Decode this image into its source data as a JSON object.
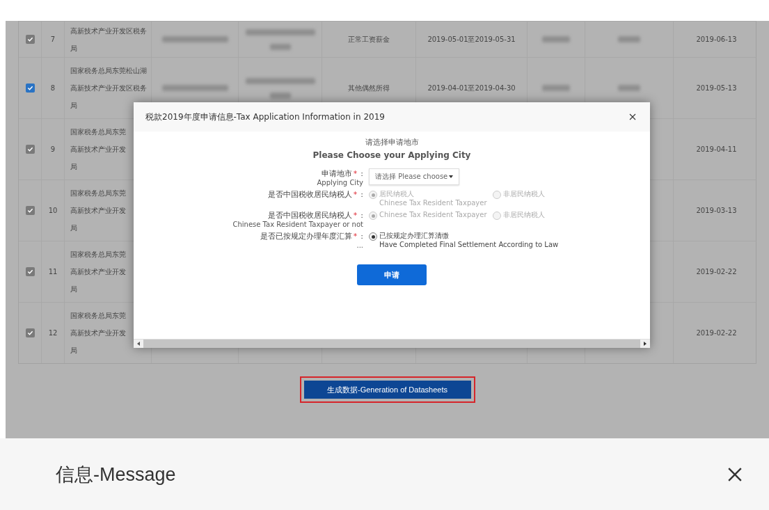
{
  "table": {
    "rows": [
      {
        "checked": true,
        "color": "#7a7a7a",
        "number": "7",
        "authority": [
          "高新技术产业开发区税务",
          "局"
        ],
        "type": "正常工资薪金",
        "period": "2019-05-01至2019-05-31",
        "date": "2019-06-13"
      },
      {
        "checked": true,
        "color": "#2a73c4",
        "number": "8",
        "authority": [
          "国家税务总局东莞松山湖",
          "高新技术产业开发区税务",
          "局"
        ],
        "type": "其他偶然所得",
        "period": "2019-04-01至2019-04-30",
        "date": "2019-05-13"
      },
      {
        "checked": true,
        "color": "#7a7a7a",
        "number": "9",
        "authority": [
          "国家税务总局东莞",
          "高新技术产业开发",
          "局"
        ],
        "date": "2019-04-11"
      },
      {
        "checked": true,
        "color": "#7a7a7a",
        "number": "10",
        "authority": [
          "国家税务总局东莞",
          "高新技术产业开发",
          "局"
        ],
        "date": "2019-03-13"
      },
      {
        "checked": true,
        "color": "#7a7a7a",
        "number": "11",
        "authority": [
          "国家税务总局东莞",
          "高新技术产业开发",
          "局"
        ],
        "date": "2019-02-22"
      },
      {
        "checked": true,
        "color": "#7a7a7a",
        "number": "12",
        "authority": [
          "国家税务总局东莞",
          "高新技术产业开发",
          "局"
        ],
        "date": "2019-02-22"
      }
    ]
  },
  "dialog": {
    "title": "税款2019年度申请信息-Tax Application Information in 2019",
    "heading": "请选择申请地市",
    "subheading": "Please Choose your Applying City",
    "fields": [
      {
        "kind": "select",
        "label": "申请地市",
        "required_mark": "*",
        "colon": ":",
        "sublabel": "Applying City",
        "placeholder": "请选择 Please choose"
      },
      {
        "kind": "radio",
        "label": "是否中国税收居民纳税人",
        "required_mark": "*",
        "colon": ":",
        "options": [
          {
            "label": "居民纳税人",
            "sublabel": "Chinese Tax Resident Taxpayer",
            "selected": true,
            "disabled": true
          },
          {
            "label": "非居民纳税人",
            "selected": false,
            "disabled": true
          }
        ]
      },
      {
        "kind": "radio",
        "label": "是否中国税收居民纳税人",
        "required_mark": "*",
        "colon": ":",
        "sublabel": "Chinese Tax Resident Taxpayer or not",
        "options": [
          {
            "label": "Chinese Tax Resident Taxpayer",
            "selected": true,
            "disabled": true
          },
          {
            "label": "非居民纳税人",
            "selected": false,
            "disabled": true
          }
        ]
      },
      {
        "kind": "radio",
        "label": "是否已按规定办理年度汇算",
        "required_mark": "*",
        "colon": ":",
        "sublabel": "...",
        "options": [
          {
            "label": "已按规定办理汇算清缴",
            "sublabel": "Have Completed Final Settlement According to Law",
            "selected": true,
            "disabled": false
          }
        ]
      }
    ],
    "submit": "申请"
  },
  "generate_button": "生成数据-Generation of Datasheets",
  "message": {
    "title": "信息-Message"
  }
}
